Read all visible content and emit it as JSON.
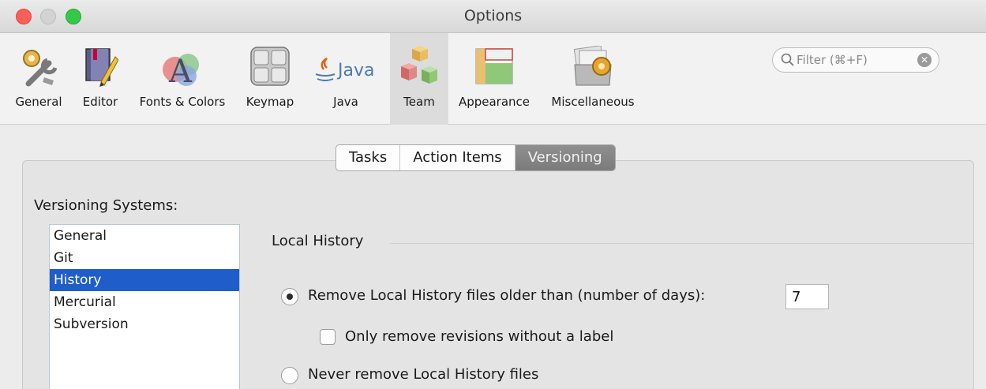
{
  "window": {
    "title": "Options"
  },
  "toolbar": {
    "items": [
      {
        "label": "General",
        "icon": "gear-wrench-icon"
      },
      {
        "label": "Editor",
        "icon": "notebook-pencil-icon"
      },
      {
        "label": "Fonts & Colors",
        "icon": "font-palette-icon"
      },
      {
        "label": "Keymap",
        "icon": "keyboard-icon"
      },
      {
        "label": "Java",
        "icon": "java-logo-icon"
      },
      {
        "label": "Team",
        "icon": "blocks-icon",
        "selected": true
      },
      {
        "label": "Appearance",
        "icon": "layout-icon"
      },
      {
        "label": "Miscellaneous",
        "icon": "folder-gear-icon"
      }
    ],
    "java_logo_text": "Java"
  },
  "filter": {
    "placeholder": "Filter (⌘+F)"
  },
  "tabs": {
    "items": [
      "Tasks",
      "Action Items",
      "Versioning"
    ],
    "active": "Versioning"
  },
  "versioning": {
    "label": "Versioning Systems:",
    "systems": [
      "General",
      "Git",
      "History",
      "Mercurial",
      "Subversion"
    ],
    "selected": "History"
  },
  "local_history": {
    "title": "Local History",
    "remove_older_label": "Remove Local History files older than (number of days):",
    "days": "7",
    "only_unlabeled_label": "Only remove revisions without a label",
    "never_remove_label": "Never remove Local History files"
  },
  "colors": {
    "selection": "#1f5dc9",
    "close": "#fc5f57",
    "maximize": "#34c849"
  }
}
